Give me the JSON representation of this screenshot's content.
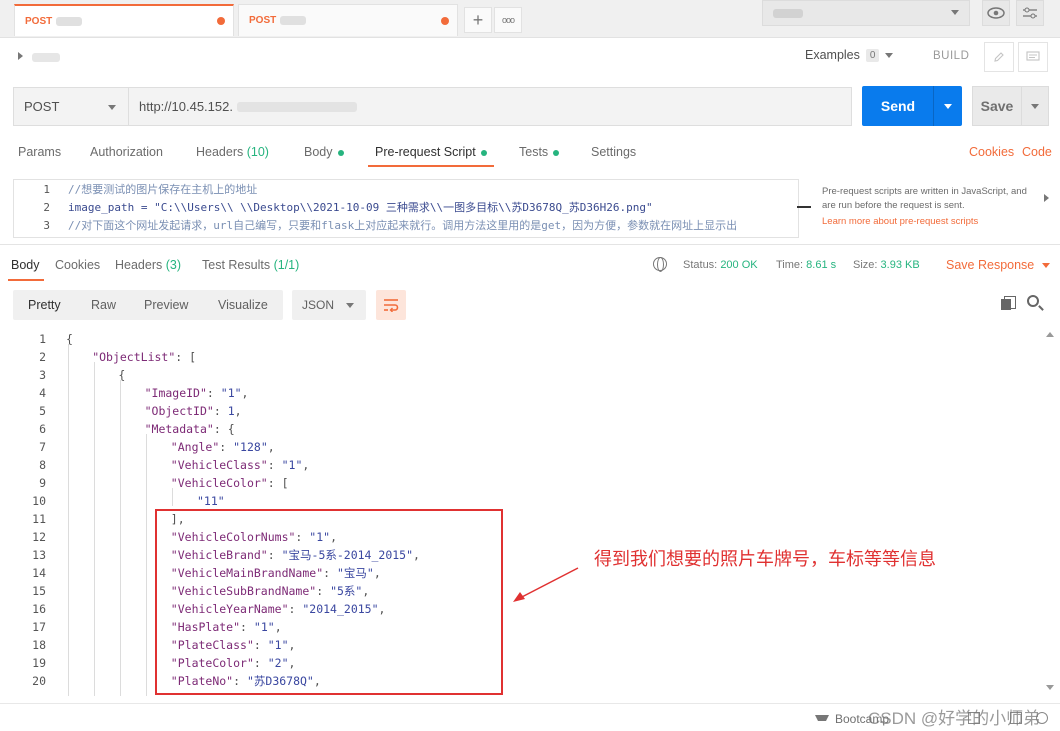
{
  "tabs": [
    {
      "method": "POST",
      "active": true
    },
    {
      "method": "POST",
      "active": false
    }
  ],
  "tab_controls": {
    "add_label": "+",
    "more_label": "ooo"
  },
  "header": {
    "examples_label": "Examples",
    "examples_count": "0",
    "build_label": "BUILD"
  },
  "request": {
    "method": "POST",
    "url": "http://10.45.152.",
    "send_label": "Send",
    "save_label": "Save"
  },
  "request_tabs": [
    {
      "label": "Params"
    },
    {
      "label": "Authorization"
    },
    {
      "label": "Headers",
      "count": "(10)"
    },
    {
      "label": "Body",
      "dot": true
    },
    {
      "label": "Pre-request Script",
      "dot": true,
      "active": true
    },
    {
      "label": "Tests",
      "dot": true
    },
    {
      "label": "Settings"
    }
  ],
  "right_links": {
    "cookies": "Cookies",
    "code": "Code"
  },
  "script": {
    "lines": [
      {
        "n": "1",
        "text": "//想要测试的图片保存在主机上的地址"
      },
      {
        "n": "2",
        "text": "image_path = \"C:\\\\Users\\\\            \\\\Desktop\\\\2021-10-09      三种需求\\\\一图多目标\\\\苏D3678Q_苏D36H26.png\""
      },
      {
        "n": "3",
        "text": "//对下面这个网址发起请求，url自己编写，只要和flask上对应起来就行。调用方法这里用的是get，因为方便，参数就在网址上显示出"
      }
    ],
    "hint": "Pre-request scripts are written in JavaScript, and are run before the request is sent.",
    "hint_link": "Learn more about pre-request scripts"
  },
  "response": {
    "tabs": [
      {
        "label": "Body",
        "active": true
      },
      {
        "label": "Cookies"
      },
      {
        "label": "Headers",
        "count": "(3)"
      },
      {
        "label": "Test Results",
        "count": "(1/1)"
      }
    ],
    "status_label": "Status:",
    "status_value": "200 OK",
    "time_label": "Time:",
    "time_value": "8.61 s",
    "size_label": "Size:",
    "size_value": "3.93 KB",
    "save_response_label": "Save Response",
    "views": [
      "Pretty",
      "Raw",
      "Preview",
      "Visualize"
    ],
    "format": "JSON"
  },
  "json_lines": [
    {
      "n": "1",
      "indent": 0,
      "parts": [
        {
          "c": "jp",
          "t": "{"
        }
      ]
    },
    {
      "n": "2",
      "indent": 1,
      "parts": [
        {
          "c": "jk",
          "t": "\"ObjectList\""
        },
        {
          "c": "jp",
          "t": ": ["
        }
      ]
    },
    {
      "n": "3",
      "indent": 2,
      "parts": [
        {
          "c": "jp",
          "t": "{"
        }
      ]
    },
    {
      "n": "4",
      "indent": 3,
      "parts": [
        {
          "c": "jk",
          "t": "\"ImageID\""
        },
        {
          "c": "jp",
          "t": ": "
        },
        {
          "c": "js",
          "t": "\"1\""
        },
        {
          "c": "jp",
          "t": ","
        }
      ]
    },
    {
      "n": "5",
      "indent": 3,
      "parts": [
        {
          "c": "jk",
          "t": "\"ObjectID\""
        },
        {
          "c": "jp",
          "t": ": "
        },
        {
          "c": "jn",
          "t": "1"
        },
        {
          "c": "jp",
          "t": ","
        }
      ]
    },
    {
      "n": "6",
      "indent": 3,
      "parts": [
        {
          "c": "jk",
          "t": "\"Metadata\""
        },
        {
          "c": "jp",
          "t": ": {"
        }
      ]
    },
    {
      "n": "7",
      "indent": 4,
      "parts": [
        {
          "c": "jk",
          "t": "\"Angle\""
        },
        {
          "c": "jp",
          "t": ": "
        },
        {
          "c": "js",
          "t": "\"128\""
        },
        {
          "c": "jp",
          "t": ","
        }
      ]
    },
    {
      "n": "8",
      "indent": 4,
      "parts": [
        {
          "c": "jk",
          "t": "\"VehicleClass\""
        },
        {
          "c": "jp",
          "t": ": "
        },
        {
          "c": "js",
          "t": "\"1\""
        },
        {
          "c": "jp",
          "t": ","
        }
      ]
    },
    {
      "n": "9",
      "indent": 4,
      "parts": [
        {
          "c": "jk",
          "t": "\"VehicleColor\""
        },
        {
          "c": "jp",
          "t": ": ["
        }
      ]
    },
    {
      "n": "10",
      "indent": 5,
      "parts": [
        {
          "c": "js",
          "t": "\"11\""
        }
      ]
    },
    {
      "n": "11",
      "indent": 4,
      "parts": [
        {
          "c": "jp",
          "t": "],"
        }
      ]
    },
    {
      "n": "12",
      "indent": 4,
      "parts": [
        {
          "c": "jk",
          "t": "\"VehicleColorNums\""
        },
        {
          "c": "jp",
          "t": ": "
        },
        {
          "c": "js",
          "t": "\"1\""
        },
        {
          "c": "jp",
          "t": ","
        }
      ]
    },
    {
      "n": "13",
      "indent": 4,
      "parts": [
        {
          "c": "jk",
          "t": "\"VehicleBrand\""
        },
        {
          "c": "jp",
          "t": ": "
        },
        {
          "c": "js",
          "t": "\"宝马-5系-2014_2015\""
        },
        {
          "c": "jp",
          "t": ","
        }
      ]
    },
    {
      "n": "14",
      "indent": 4,
      "parts": [
        {
          "c": "jk",
          "t": "\"VehicleMainBrandName\""
        },
        {
          "c": "jp",
          "t": ": "
        },
        {
          "c": "js",
          "t": "\"宝马\""
        },
        {
          "c": "jp",
          "t": ","
        }
      ]
    },
    {
      "n": "15",
      "indent": 4,
      "parts": [
        {
          "c": "jk",
          "t": "\"VehicleSubBrandName\""
        },
        {
          "c": "jp",
          "t": ": "
        },
        {
          "c": "js",
          "t": "\"5系\""
        },
        {
          "c": "jp",
          "t": ","
        }
      ]
    },
    {
      "n": "16",
      "indent": 4,
      "parts": [
        {
          "c": "jk",
          "t": "\"VehicleYearName\""
        },
        {
          "c": "jp",
          "t": ": "
        },
        {
          "c": "js",
          "t": "\"2014_2015\""
        },
        {
          "c": "jp",
          "t": ","
        }
      ]
    },
    {
      "n": "17",
      "indent": 4,
      "parts": [
        {
          "c": "jk",
          "t": "\"HasPlate\""
        },
        {
          "c": "jp",
          "t": ": "
        },
        {
          "c": "js",
          "t": "\"1\""
        },
        {
          "c": "jp",
          "t": ","
        }
      ]
    },
    {
      "n": "18",
      "indent": 4,
      "parts": [
        {
          "c": "jk",
          "t": "\"PlateClass\""
        },
        {
          "c": "jp",
          "t": ": "
        },
        {
          "c": "js",
          "t": "\"1\""
        },
        {
          "c": "jp",
          "t": ","
        }
      ]
    },
    {
      "n": "19",
      "indent": 4,
      "parts": [
        {
          "c": "jk",
          "t": "\"PlateColor\""
        },
        {
          "c": "jp",
          "t": ": "
        },
        {
          "c": "js",
          "t": "\"2\""
        },
        {
          "c": "jp",
          "t": ","
        }
      ]
    },
    {
      "n": "20",
      "indent": 4,
      "parts": [
        {
          "c": "jk",
          "t": "\"PlateNo\""
        },
        {
          "c": "jp",
          "t": ": "
        },
        {
          "c": "js",
          "t": "\"苏D3678Q\""
        },
        {
          "c": "jp",
          "t": ","
        }
      ]
    }
  ],
  "annotation": {
    "text": "得到我们想要的照片车牌号，车标等等信息",
    "color": "#e03131"
  },
  "footer": {
    "bootcamp": "Bootcamp",
    "watermark": "CSDN @好学的小师弟"
  },
  "colors": {
    "accent": "#f26b3a",
    "primary": "#097bed",
    "success": "#26b47f"
  }
}
